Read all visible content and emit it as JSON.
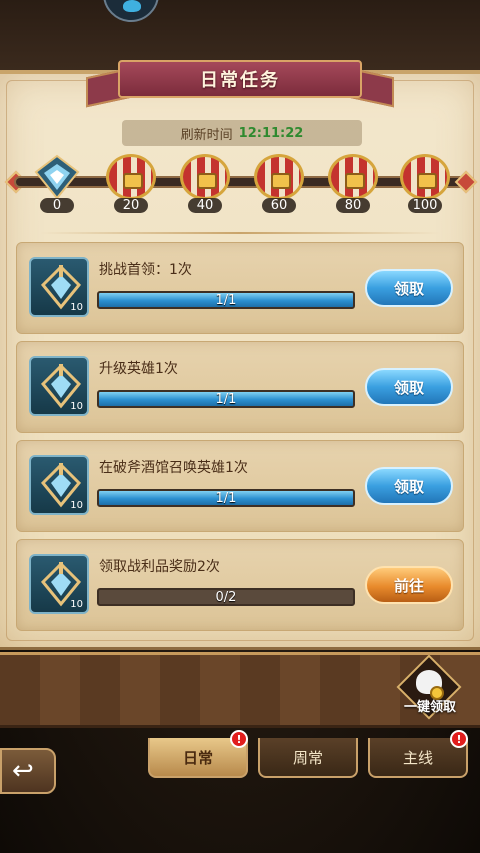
{
  "title": "日常任务",
  "refresh": {
    "label": "刷新时间",
    "time": "12:11:22"
  },
  "milestones": [
    {
      "value": "0",
      "kind": "emblem"
    },
    {
      "value": "20",
      "kind": "chest"
    },
    {
      "value": "40",
      "kind": "chest"
    },
    {
      "value": "60",
      "kind": "chest"
    },
    {
      "value": "80",
      "kind": "chest"
    },
    {
      "value": "100",
      "kind": "chest"
    }
  ],
  "tasks": [
    {
      "name": "挑战首领：1次",
      "reward": "10",
      "progress": "1/1",
      "fraction": 1.0,
      "button": "领取",
      "button_type": "claim"
    },
    {
      "name": "升级英雄1次",
      "reward": "10",
      "progress": "1/1",
      "fraction": 1.0,
      "button": "领取",
      "button_type": "claim"
    },
    {
      "name": "在破斧酒馆召唤英雄1次",
      "reward": "10",
      "progress": "1/1",
      "fraction": 1.0,
      "button": "领取",
      "button_type": "claim"
    },
    {
      "name": "领取战利品奖励2次",
      "reward": "10",
      "progress": "0/2",
      "fraction": 0.0,
      "button": "前往",
      "button_type": "go"
    }
  ],
  "claim_all": {
    "label": "一键领取"
  },
  "tabs": [
    {
      "label": "日常",
      "active": true,
      "badge": "!"
    },
    {
      "label": "周常",
      "active": false,
      "badge": ""
    },
    {
      "label": "主线",
      "active": false,
      "badge": "!"
    }
  ],
  "colors": {
    "claim_button": "#3a9fe0",
    "go_button": "#e88a2c",
    "ribbon": "#8d3a4a",
    "time_text": "#2f8a2f"
  }
}
